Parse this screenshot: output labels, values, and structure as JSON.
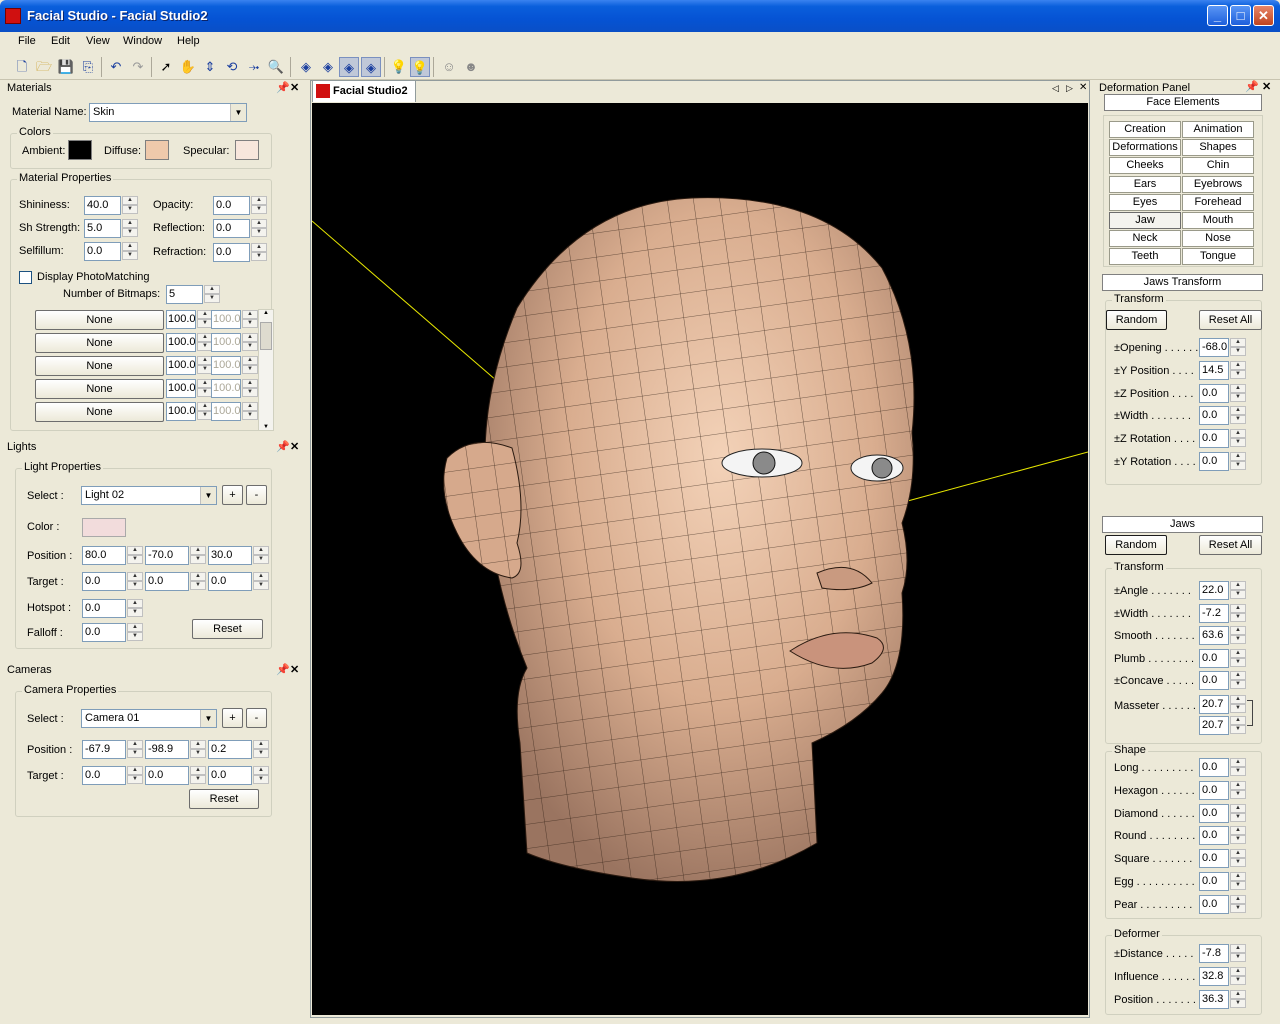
{
  "app": {
    "title": "Facial Studio - Facial Studio2"
  },
  "menu": [
    "File",
    "Edit",
    "View",
    "Window",
    "Help"
  ],
  "doc_tab": "Facial Studio2",
  "materials": {
    "title": "Materials",
    "name_label": "Material Name:",
    "name_value": "Skin",
    "colors_legend": "Colors",
    "ambient_label": "Ambient:",
    "diffuse_label": "Diffuse:",
    "specular_label": "Specular:",
    "ambient_color": "#000000",
    "diffuse_color": "#efc9ab",
    "specular_color": "#f7e6dc",
    "props_legend": "Material Properties",
    "shininess_label": "Shininess:",
    "shininess": "40.0",
    "opacity_label": "Opacity:",
    "opacity": "0.0",
    "sh_strength_label": "Sh Strength:",
    "sh_strength": "5.0",
    "reflection_label": "Reflection:",
    "reflection": "0.0",
    "selfillum_label": "Selfillum:",
    "selfillum": "0.0",
    "refraction_label": "Refraction:",
    "refraction": "0.0",
    "photomatch_label": "Display PhotoMatching",
    "num_bitmaps_label": "Number of Bitmaps:",
    "num_bitmaps": "5",
    "bitmaps": [
      {
        "name": "None",
        "value": "100.0",
        "value2": "100.0"
      },
      {
        "name": "None",
        "value": "100.0",
        "value2": "100.0"
      },
      {
        "name": "None",
        "value": "100.0",
        "value2": "100.0"
      },
      {
        "name": "None",
        "value": "100.0",
        "value2": "100.0"
      },
      {
        "name": "None",
        "value": "100.0",
        "value2": "100.0"
      }
    ]
  },
  "lights": {
    "title": "Lights",
    "legend": "Light Properties",
    "select_label": "Select :",
    "select_value": "Light 02",
    "plus": "+",
    "minus": "-",
    "color_label": "Color :",
    "light_color": "#f2dcdc",
    "position_label": "Position :",
    "position": [
      "80.0",
      "-70.0",
      "30.0"
    ],
    "target_label": "Target :",
    "target": [
      "0.0",
      "0.0",
      "0.0"
    ],
    "hotspot_label": "Hotspot :",
    "hotspot": "0.0",
    "falloff_label": "Falloff :",
    "falloff": "0.0",
    "reset": "Reset"
  },
  "cameras": {
    "title": "Cameras",
    "legend": "Camera Properties",
    "select_label": "Select :",
    "select_value": "Camera 01",
    "plus": "+",
    "minus": "-",
    "position_label": "Position :",
    "position": [
      "-67.9",
      "-98.9",
      "0.2"
    ],
    "target_label": "Target :",
    "target": [
      "0.0",
      "0.0",
      "0.0"
    ],
    "reset": "Reset"
  },
  "deformation": {
    "title": "Deformation Panel",
    "face_elements_title": "Face Elements",
    "elements": [
      "Creation",
      "Animation",
      "Deformations",
      "Shapes",
      "Cheeks",
      "Chin",
      "Ears",
      "Eyebrows",
      "Eyes",
      "Forehead",
      "Jaw",
      "Mouth",
      "Neck",
      "Nose",
      "Teeth",
      "Tongue"
    ],
    "selected_element": "Jaw",
    "jaws_transform_title": "Jaws Transform",
    "transform_legend": "Transform",
    "random": "Random",
    "reset_all": "Reset All",
    "jt_rows": [
      {
        "label": "±Opening . . . . . .",
        "value": "-68.0"
      },
      {
        "label": "±Y Position . . . .",
        "value": "14.5"
      },
      {
        "label": "±Z Position . . . .",
        "value": "0.0"
      },
      {
        "label": "±Width . . . . . . .",
        "value": "0.0"
      },
      {
        "label": "±Z Rotation . . . .",
        "value": "0.0"
      },
      {
        "label": "±Y Rotation . . . .",
        "value": "0.0"
      }
    ],
    "jaws_title": "Jaws",
    "jaws_transform_rows": [
      {
        "label": "±Angle . . . . . . .",
        "value": "22.0"
      },
      {
        "label": "±Width . . . . . . .",
        "value": "-7.2"
      },
      {
        "label": "Smooth . . . . . . .",
        "value": "63.6"
      },
      {
        "label": "Plumb . . . . . . . .",
        "value": "0.0"
      },
      {
        "label": "±Concave . . . . .",
        "value": "0.0"
      }
    ],
    "masseter_label": "Masseter . . . . . .",
    "masseter": [
      "20.7",
      "20.7"
    ],
    "shape_legend": "Shape",
    "shape_rows": [
      {
        "label": "Long . . . . . . . . .",
        "value": "0.0"
      },
      {
        "label": "Hexagon . . . . . .",
        "value": "0.0"
      },
      {
        "label": "Diamond . . . . . .",
        "value": "0.0"
      },
      {
        "label": "Round . . . . . . . .",
        "value": "0.0"
      },
      {
        "label": "Square . . . . . . .",
        "value": "0.0"
      },
      {
        "label": "Egg . . . . . . . . . .",
        "value": "0.0"
      },
      {
        "label": "Pear . . . . . . . . .",
        "value": "0.0"
      }
    ],
    "deformer_legend": "Deformer",
    "deformer_rows": [
      {
        "label": "±Distance . . . . .",
        "value": "-7.8"
      },
      {
        "label": "Influence . . . . . .",
        "value": "32.8"
      },
      {
        "label": "Position . . . . . . .",
        "value": "36.3"
      }
    ]
  }
}
